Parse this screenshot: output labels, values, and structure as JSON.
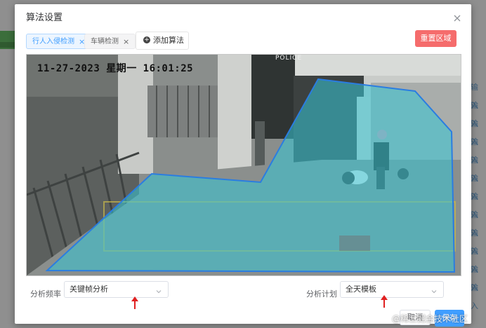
{
  "dialog": {
    "title": "算法设置",
    "tags": [
      {
        "label": "行人入侵检测",
        "close": "×"
      },
      {
        "label": "车辆检测",
        "close": "×"
      }
    ],
    "add_label": "添加算法",
    "reset_label": "重置区域"
  },
  "video": {
    "osd_text": "11-27-2023  星期一 16:01:25",
    "police_text": "POLICE",
    "region_color": "#35c6d6",
    "region_border": "#2a7de1"
  },
  "form": {
    "frequency_label": "分析频率",
    "frequency_value": "关键帧分析",
    "plan_label": "分析计划",
    "plan_value": "全天模板"
  },
  "footer": {
    "cancel_label": "取消",
    "save_label": "保存"
  },
  "background": {
    "right_links": [
      "输入",
      "输入",
      "输入",
      "输入",
      "输入",
      "输入",
      "输入",
      "输入",
      "输入",
      "输入",
      "输入",
      "输入"
    ]
  },
  "watermark": "@稀土掘金技术社区",
  "colors": {
    "primary": "#409eff",
    "danger": "#f56c6c",
    "annotation_arrow": "#e02020"
  }
}
